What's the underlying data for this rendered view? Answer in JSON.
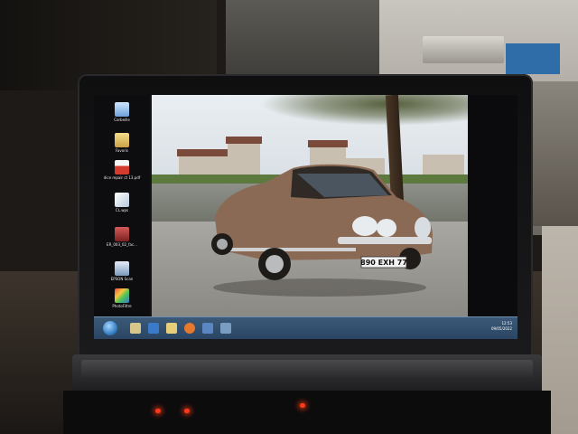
{
  "desktop": {
    "icons": [
      {
        "label": "Corbeille",
        "icon": "recycle-bin-icon",
        "color": "#7fb2e6"
      },
      {
        "label": "Favoris",
        "icon": "folder-icon",
        "color": "#e8c76a"
      },
      {
        "label": "dice repair ct 13.pdf",
        "icon": "pdf-icon",
        "color": "#d33b2f"
      },
      {
        "label": "CL.wps",
        "icon": "document-icon",
        "color": "#dfe7f2"
      },
      {
        "label": "ER_003_02_fac...",
        "icon": "archive-icon",
        "color": "#b03a3a"
      },
      {
        "label": "EPSON Scan",
        "icon": "scanner-icon",
        "color": "#8aa6c8"
      },
      {
        "label": "PhotoFiltre",
        "icon": "photo-editor-icon",
        "color": "#e0a23a"
      }
    ]
  },
  "wallpaper": {
    "car_plate": "890 EXH 77",
    "car_color": "#8b6a55"
  },
  "taskbar": {
    "clock_time": "12:53",
    "clock_date": "09/05/2022",
    "buttons": [
      {
        "icon": "explorer-icon",
        "color": "#d9c68a"
      },
      {
        "icon": "media-icon",
        "color": "#3a7acb"
      },
      {
        "icon": "folder-icon",
        "color": "#e6cd7a"
      },
      {
        "icon": "firefox-icon",
        "color": "#e6792e"
      },
      {
        "icon": "document-icon",
        "color": "#5a86c2"
      },
      {
        "icon": "window-icon",
        "color": "#7a9dc2"
      }
    ]
  },
  "colors": {
    "taskbar": "#2f4e6e",
    "bezel": "#111113",
    "led": "#ff3a1a"
  }
}
